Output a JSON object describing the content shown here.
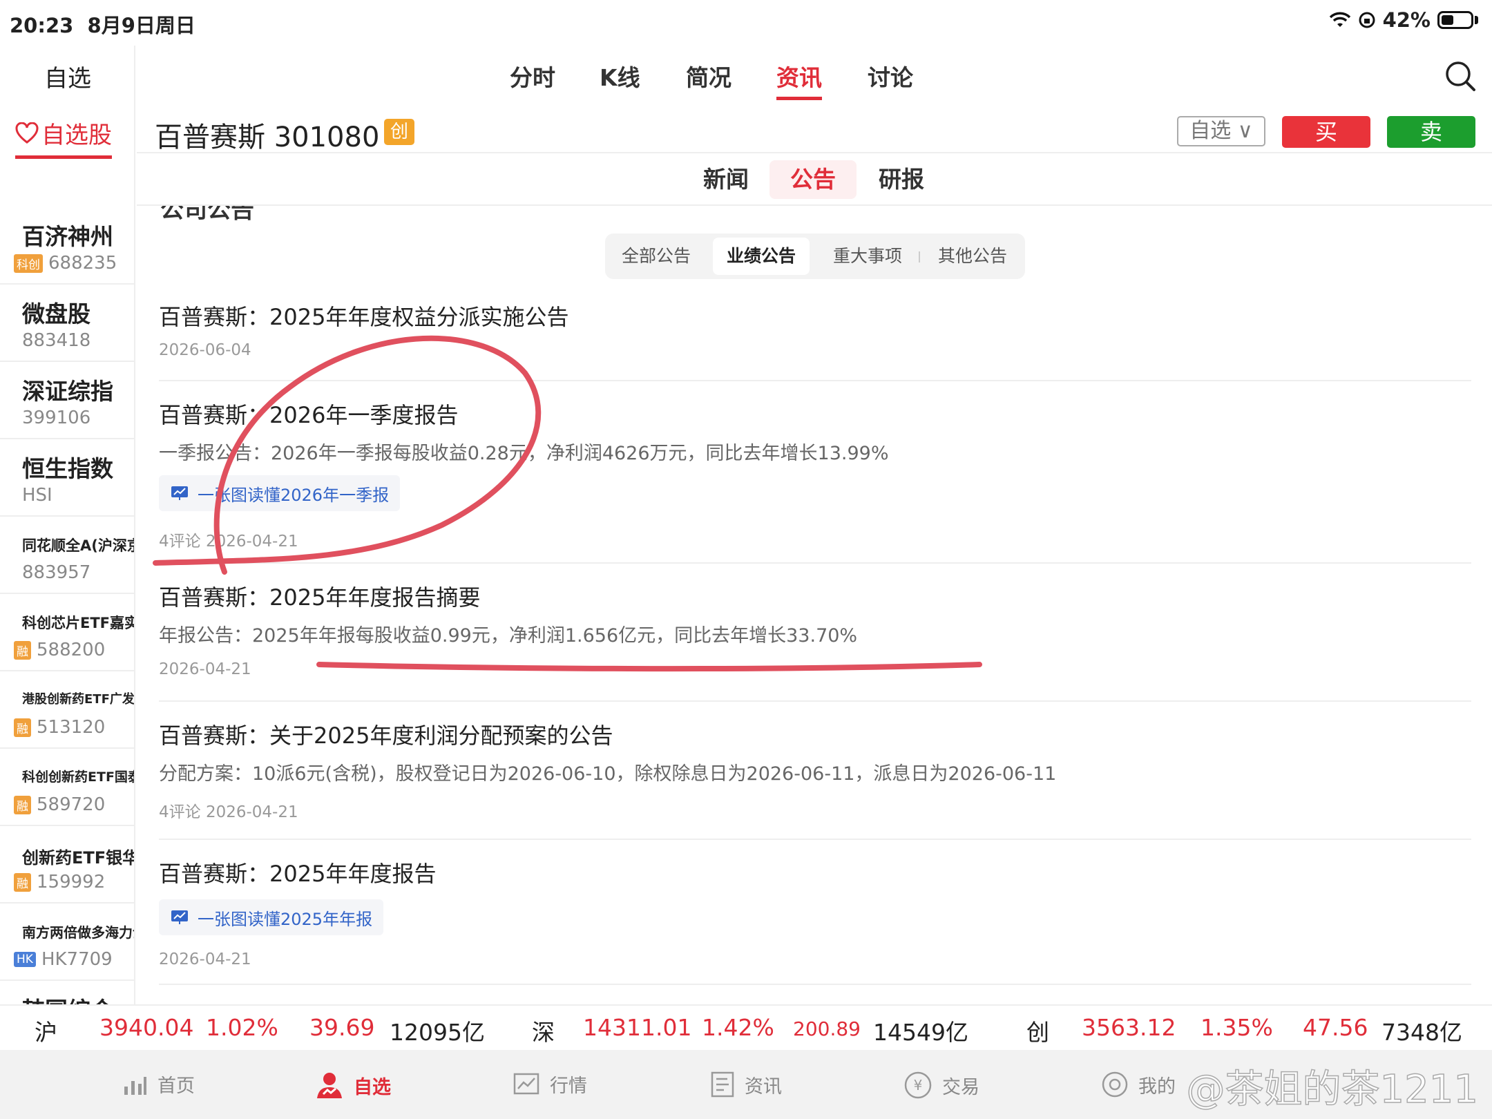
{
  "status_bar": {
    "time": "20:23",
    "date": "8月9日周日",
    "battery": "42%"
  },
  "sidebar": {
    "title": "自选",
    "active_tab": "自选股",
    "items": [
      {
        "name": "百济神州",
        "code": "688235",
        "tag": "科创"
      },
      {
        "name": "微盘股",
        "code": "883418",
        "tag": ""
      },
      {
        "name": "深证综指",
        "code": "399106",
        "tag": ""
      },
      {
        "name": "恒生指数",
        "code": "HSI",
        "tag": ""
      },
      {
        "name": "同花顺全A(沪深京)",
        "code": "883957",
        "tag": ""
      },
      {
        "name": "科创芯片ETF嘉实",
        "code": "588200",
        "tag": "融"
      },
      {
        "name": "港股创新药ETF广发",
        "code": "513120",
        "tag": "融"
      },
      {
        "name": "科创创新药ETF国泰",
        "code": "589720",
        "tag": "融"
      },
      {
        "name": "创新药ETF银华",
        "code": "159992",
        "tag": "融"
      },
      {
        "name": "南方两倍做多海力士",
        "code": "HK7709",
        "tag": "HK"
      },
      {
        "name": "韩国综合",
        "code": "",
        "tag": ""
      }
    ]
  },
  "top_tabs": [
    "分时",
    "K线",
    "简况",
    "资讯",
    "讨论"
  ],
  "active_top_tab": "资讯",
  "stock": {
    "title": "百普赛斯 301080",
    "board": "创",
    "watch_label": "自选 ∨",
    "buy_label": "买",
    "sell_label": "卖"
  },
  "sub_tabs": [
    "新闻",
    "公告",
    "研报"
  ],
  "active_sub_tab": "公告",
  "partial_heading": "公司公告",
  "filters": [
    "全部公告",
    "业绩公告",
    "重大事项",
    "其他公告"
  ],
  "active_filter": "业绩公告",
  "announcements": [
    {
      "title": "百普赛斯：2025年年度权益分派实施公告",
      "desc": "",
      "chip": "",
      "meta": "2026-06-04"
    },
    {
      "title": "百普赛斯：2026年一季度报告",
      "desc": "一季报公告：2026年一季报每股收益0.28元，净利润4626万元，同比去年增长13.99%",
      "chip": "一张图读懂2026年一季报",
      "meta": "4评论  2026-04-21"
    },
    {
      "title": "百普赛斯：2025年年度报告摘要",
      "desc": "年报公告：2025年年报每股收益0.99元，净利润1.656亿元，同比去年增长33.70%",
      "chip": "",
      "meta": "2026-04-21"
    },
    {
      "title": "百普赛斯：关于2025年度利润分配预案的公告",
      "desc": "分配方案：10派6元(含税)，股权登记日为2026-06-10，除权除息日为2026-06-11，派息日为2026-06-11",
      "chip": "",
      "meta": "4评论  2026-04-21"
    },
    {
      "title": "百普赛斯：2025年年度报告",
      "desc": "",
      "chip": "一张图读懂2025年年报",
      "meta": "2026-04-21"
    }
  ],
  "market": {
    "sh": {
      "label": "沪",
      "price": "3940.04",
      "pct": "1.02%",
      "chg": "39.69",
      "vol": "12095亿"
    },
    "sz": {
      "label": "深",
      "price": "14311.01",
      "pct": "1.42%",
      "chg": "200.89",
      "vol": "14549亿"
    },
    "cy": {
      "label": "创",
      "price": "3563.12",
      "pct": "1.35%",
      "chg": "47.56",
      "vol": "7348亿"
    }
  },
  "bottom_nav": [
    "首页",
    "自选",
    "行情",
    "资讯",
    "交易",
    "我的"
  ],
  "active_bottom": "自选",
  "watermark": "@茶姐的茶1211",
  "colors": {
    "accent_red": "#e02d39",
    "buy_red": "#e9333a",
    "sell_green": "#1c9e2e",
    "board_orange": "#f3a52a",
    "link_blue": "#3264c8"
  }
}
